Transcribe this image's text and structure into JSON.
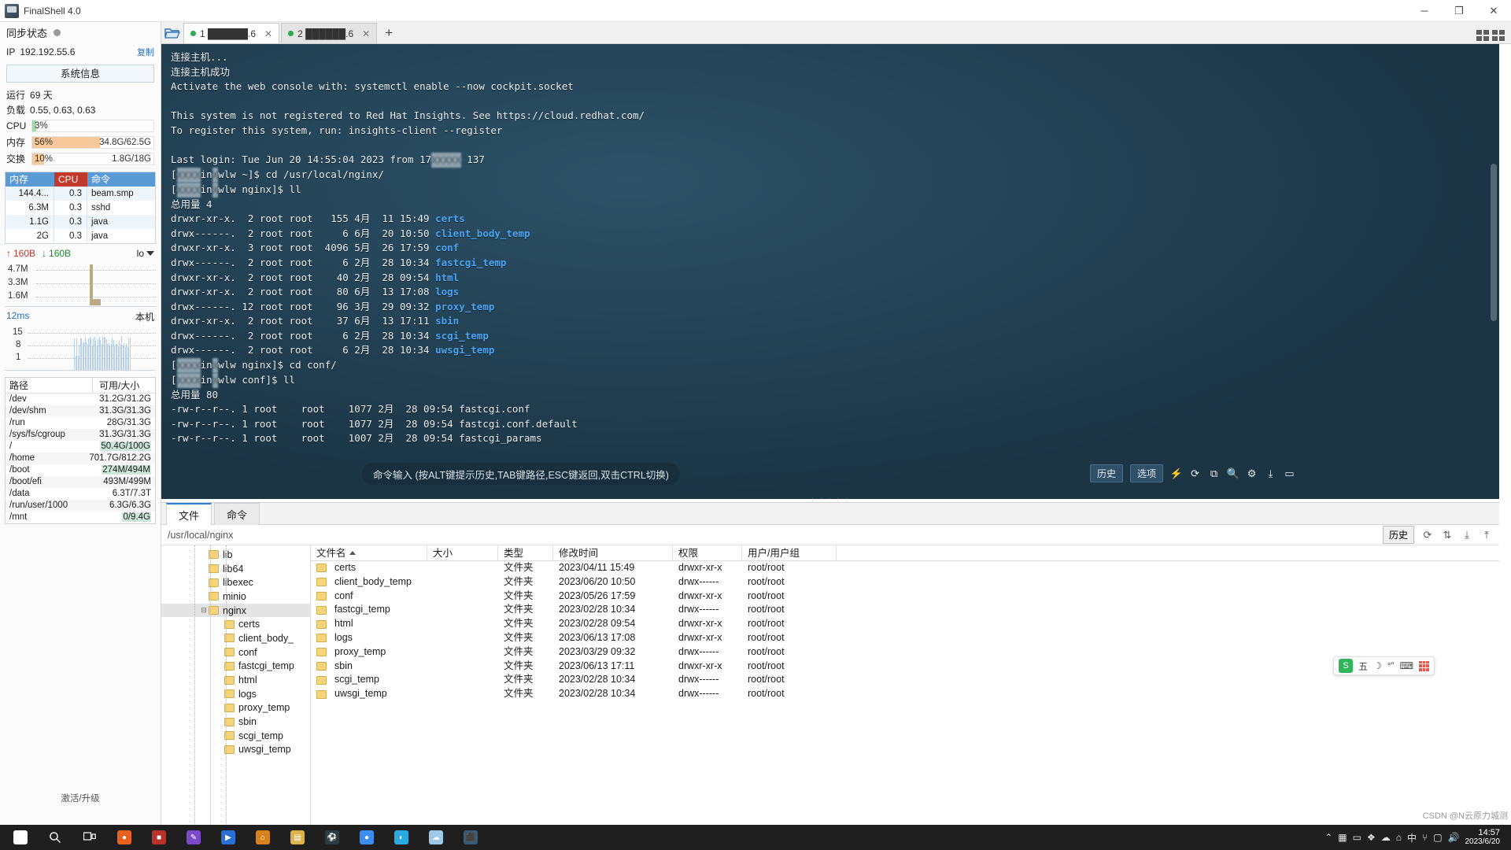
{
  "titlebar": {
    "app_title": "FinalShell 4.0",
    "minimize": "─",
    "maximize": "❐",
    "close": "✕"
  },
  "sidebar": {
    "sync_label": "同步状态",
    "ip_label": "IP",
    "ip_value": "192.192.55.6",
    "copy_label": "复制",
    "sysinfo_button": "系统信息",
    "uptime_label": "运行",
    "uptime_value": "69 天",
    "load_label": "负载",
    "load_value": "0.55, 0.63, 0.63",
    "gauges": [
      {
        "name": "CPU",
        "pct": "3%",
        "fill": 3,
        "right": "",
        "color": "#9ddfa0"
      },
      {
        "name": "内存",
        "pct": "56%",
        "fill": 56,
        "right": "34.8G/62.5G",
        "color": "#f6c89a"
      },
      {
        "name": "交换",
        "pct": "10%",
        "fill": 10,
        "right": "1.8G/18G",
        "color": "#f6c89a"
      }
    ],
    "proc_headers": {
      "mem": "内存",
      "cpu": "CPU",
      "cmd": "命令"
    },
    "processes": [
      {
        "mem": "144.4...",
        "cpu": "0.3",
        "cmd": "beam.smp"
      },
      {
        "mem": "6.3M",
        "cpu": "0.3",
        "cmd": "sshd"
      },
      {
        "mem": "1.1G",
        "cpu": "0.3",
        "cmd": "java"
      },
      {
        "mem": "2G",
        "cpu": "0.3",
        "cmd": "java"
      }
    ],
    "net": {
      "up_icon": "↑",
      "up_value": "160B",
      "down_icon": "↓",
      "down_value": "160B",
      "interface": "lo",
      "y_labels": [
        "4.7M",
        "3.3M",
        "1.6M"
      ]
    },
    "latency": {
      "value": "12ms",
      "local_label": "本机",
      "y_labels": [
        "15",
        "8",
        "1"
      ]
    },
    "disk_headers": {
      "path": "路径",
      "size": "可用/大小"
    },
    "disks": [
      {
        "path": "/dev",
        "size": "31.2G/31.2G",
        "hl": false
      },
      {
        "path": "/dev/shm",
        "size": "31.3G/31.3G",
        "hl": false
      },
      {
        "path": "/run",
        "size": "28G/31.3G",
        "hl": false
      },
      {
        "path": "/sys/fs/cgroup",
        "size": "31.3G/31.3G",
        "hl": false
      },
      {
        "path": "/",
        "size": "50.4G/100G",
        "hl": true
      },
      {
        "path": "/home",
        "size": "701.7G/812.2G",
        "hl": false
      },
      {
        "path": "/boot",
        "size": "274M/494M",
        "hl": true
      },
      {
        "path": "/boot/efi",
        "size": "493M/499M",
        "hl": false
      },
      {
        "path": "/data",
        "size": "6.3T/7.3T",
        "hl": false
      },
      {
        "path": "/run/user/1000",
        "size": "6.3G/6.3G",
        "hl": false
      },
      {
        "path": "/mnt",
        "size": "0/9.4G",
        "hl": true
      }
    ],
    "activate_label": "激活/升级"
  },
  "tabbar": {
    "folder_icon": "folder-open-icon",
    "tabs": [
      {
        "index": "1",
        "label": "1 ██████.6",
        "active": true,
        "close": "✕"
      },
      {
        "index": "2",
        "label": "2 ██████.6",
        "active": false,
        "close": "✕"
      }
    ],
    "add_tab": "+"
  },
  "terminal": {
    "lines": [
      {
        "t": "连接主机..."
      },
      {
        "t": "连接主机成功"
      },
      {
        "t": "Activate the web console with: systemctl enable --now cockpit.socket"
      },
      {
        "t": ""
      },
      {
        "t": "This system is not registered to Red Hat Insights. See https://cloud.redhat.com/"
      },
      {
        "t": "To register this system, run: insights-client --register"
      },
      {
        "t": ""
      },
      {
        "t": "Last login: Tue Jun 20 14:55:04 2023 from 17@@@@@ 137",
        "blur": true
      },
      {
        "t": "[@@@@in@wlw ~]$ cd /usr/local/nginx/",
        "blur": true
      },
      {
        "t": "[@@@@in@wlw nginx]$ ll",
        "blur": true
      },
      {
        "t": "总用量 4"
      },
      {
        "perm": "drwxr-xr-x.",
        "links": "2",
        "user": "root",
        "group": "root",
        "size": "155",
        "month": "4月",
        "day": "11",
        "time": "15:49",
        "name": "certs"
      },
      {
        "perm": "drwx------.",
        "links": "2",
        "user": "root",
        "group": "root",
        "size": "6",
        "month": "6月",
        "day": "20",
        "time": "10:50",
        "name": "client_body_temp"
      },
      {
        "perm": "drwxr-xr-x.",
        "links": "3",
        "user": "root",
        "group": "root",
        "size": "4096",
        "month": "5月",
        "day": "26",
        "time": "17:59",
        "name": "conf"
      },
      {
        "perm": "drwx------.",
        "links": "2",
        "user": "root",
        "group": "root",
        "size": "6",
        "month": "2月",
        "day": "28",
        "time": "10:34",
        "name": "fastcgi_temp"
      },
      {
        "perm": "drwxr-xr-x.",
        "links": "2",
        "user": "root",
        "group": "root",
        "size": "40",
        "month": "2月",
        "day": "28",
        "time": "09:54",
        "name": "html"
      },
      {
        "perm": "drwxr-xr-x.",
        "links": "2",
        "user": "root",
        "group": "root",
        "size": "80",
        "month": "6月",
        "day": "13",
        "time": "17:08",
        "name": "logs"
      },
      {
        "perm": "drwx------.",
        "links": "12",
        "user": "root",
        "group": "root",
        "size": "96",
        "month": "3月",
        "day": "29",
        "time": "09:32",
        "name": "proxy_temp"
      },
      {
        "perm": "drwxr-xr-x.",
        "links": "2",
        "user": "root",
        "group": "root",
        "size": "37",
        "month": "6月",
        "day": "13",
        "time": "17:11",
        "name": "sbin"
      },
      {
        "perm": "drwx------.",
        "links": "2",
        "user": "root",
        "group": "root",
        "size": "6",
        "month": "2月",
        "day": "28",
        "time": "10:34",
        "name": "scgi_temp"
      },
      {
        "perm": "drwx------.",
        "links": "2",
        "user": "root",
        "group": "root",
        "size": "6",
        "month": "2月",
        "day": "28",
        "time": "10:34",
        "name": "uwsgi_temp"
      },
      {
        "t": "[@@@@in@wlw nginx]$ cd conf/",
        "blur": true
      },
      {
        "t": "[@@@@in@wlw conf]$ ll",
        "blur": true
      },
      {
        "t": "总用量 80"
      },
      {
        "t": "-rw-r--r--. 1 root    root    1077 2月  28 09:54 fastcgi.conf"
      },
      {
        "t": "-rw-r--r--. 1 root    root    1077 2月  28 09:54 fastcgi.conf.default"
      },
      {
        "t": "-rw-r--r--. 1 root    root    1007 2月  28 09:54 fastcgi_params"
      }
    ],
    "hint": "命令输入 (按ALT键提示历史,TAB键路径,ESC键返回,双击CTRL切换)",
    "toolbar": {
      "history_label": "历史",
      "options_label": "选项",
      "icons": [
        "bolt-icon",
        "refresh-icon",
        "copy-icon",
        "search-icon",
        "gear-icon",
        "download-icon",
        "window-icon"
      ]
    }
  },
  "filepanel": {
    "tabs": [
      {
        "label": "文件",
        "active": true
      },
      {
        "label": "命令",
        "active": false
      }
    ],
    "path": "/usr/local/nginx",
    "history_label": "历史",
    "toolbar_icons": [
      "refresh-icon",
      "upload-icon",
      "download-icon",
      "upload-alt-icon"
    ],
    "tree": [
      {
        "label": "lib",
        "depth": 2,
        "expander": "",
        "selected": false
      },
      {
        "label": "lib64",
        "depth": 2,
        "expander": "",
        "selected": false
      },
      {
        "label": "libexec",
        "depth": 2,
        "expander": "",
        "selected": false
      },
      {
        "label": "minio",
        "depth": 2,
        "expander": "",
        "selected": false
      },
      {
        "label": "nginx",
        "depth": 2,
        "expander": "⊟",
        "selected": true
      },
      {
        "label": "certs",
        "depth": 3,
        "expander": "",
        "selected": false
      },
      {
        "label": "client_body_",
        "depth": 3,
        "expander": "",
        "selected": false
      },
      {
        "label": "conf",
        "depth": 3,
        "expander": "",
        "selected": false
      },
      {
        "label": "fastcgi_temp",
        "depth": 3,
        "expander": "",
        "selected": false
      },
      {
        "label": "html",
        "depth": 3,
        "expander": "",
        "selected": false
      },
      {
        "label": "logs",
        "depth": 3,
        "expander": "",
        "selected": false
      },
      {
        "label": "proxy_temp",
        "depth": 3,
        "expander": "",
        "selected": false
      },
      {
        "label": "sbin",
        "depth": 3,
        "expander": "",
        "selected": false
      },
      {
        "label": "scgi_temp",
        "depth": 3,
        "expander": "",
        "selected": false
      },
      {
        "label": "uwsgi_temp",
        "depth": 3,
        "expander": "",
        "selected": false
      }
    ],
    "columns": [
      {
        "key": "name",
        "label": "文件名",
        "sorted": true
      },
      {
        "key": "size",
        "label": "大小",
        "sorted": false
      },
      {
        "key": "type",
        "label": "类型",
        "sorted": false
      },
      {
        "key": "time",
        "label": "修改时间",
        "sorted": false
      },
      {
        "key": "perm",
        "label": "权限",
        "sorted": false
      },
      {
        "key": "own",
        "label": "用户/用户组",
        "sorted": false
      }
    ],
    "rows": [
      {
        "name": "certs",
        "size": "",
        "type": "文件夹",
        "time": "2023/04/11 15:49",
        "perm": "drwxr-xr-x",
        "own": "root/root"
      },
      {
        "name": "client_body_temp",
        "size": "",
        "type": "文件夹",
        "time": "2023/06/20 10:50",
        "perm": "drwx------",
        "own": "root/root"
      },
      {
        "name": "conf",
        "size": "",
        "type": "文件夹",
        "time": "2023/05/26 17:59",
        "perm": "drwxr-xr-x",
        "own": "root/root"
      },
      {
        "name": "fastcgi_temp",
        "size": "",
        "type": "文件夹",
        "time": "2023/02/28 10:34",
        "perm": "drwx------",
        "own": "root/root"
      },
      {
        "name": "html",
        "size": "",
        "type": "文件夹",
        "time": "2023/02/28 09:54",
        "perm": "drwxr-xr-x",
        "own": "root/root"
      },
      {
        "name": "logs",
        "size": "",
        "type": "文件夹",
        "time": "2023/06/13 17:08",
        "perm": "drwxr-xr-x",
        "own": "root/root"
      },
      {
        "name": "proxy_temp",
        "size": "",
        "type": "文件夹",
        "time": "2023/03/29 09:32",
        "perm": "drwx------",
        "own": "root/root"
      },
      {
        "name": "sbin",
        "size": "",
        "type": "文件夹",
        "time": "2023/06/13 17:11",
        "perm": "drwxr-xr-x",
        "own": "root/root"
      },
      {
        "name": "scgi_temp",
        "size": "",
        "type": "文件夹",
        "time": "2023/02/28 10:34",
        "perm": "drwx------",
        "own": "root/root"
      },
      {
        "name": "uwsgi_temp",
        "size": "",
        "type": "文件夹",
        "time": "2023/02/28 10:34",
        "perm": "drwx------",
        "own": "root/root"
      }
    ]
  },
  "sogou": {
    "logo": "S",
    "mode": "五",
    "moon": "☽",
    "quote": "°”",
    "kb": "⌨",
    "grid": "grid-icon"
  },
  "taskbar": {
    "start_icon": "windows-icon",
    "search_icon": "search-icon",
    "taskview_icon": "task-view-icon",
    "apps": [
      {
        "name": "firefox",
        "color": "#e8621f",
        "glyph": "●"
      },
      {
        "name": "app-red",
        "color": "#b8322c",
        "glyph": "■"
      },
      {
        "name": "app-purple",
        "color": "#7c4ac9",
        "glyph": "✎"
      },
      {
        "name": "app-blue",
        "color": "#2a6fd4",
        "glyph": "▶"
      },
      {
        "name": "app-orange",
        "color": "#d8821e",
        "glyph": "⌂"
      },
      {
        "name": "app-folder",
        "color": "#dcb24c",
        "glyph": "▤"
      },
      {
        "name": "app-dark",
        "color": "#2b3b46",
        "glyph": "⚽"
      },
      {
        "name": "chrome",
        "color": "#3b8ef0",
        "glyph": "●"
      },
      {
        "name": "edge",
        "color": "#2aa9e0",
        "glyph": "◐"
      },
      {
        "name": "cloud",
        "color": "#9ec8e8",
        "glyph": "☁"
      },
      {
        "name": "finalshell",
        "color": "#3a5a75",
        "glyph": "⬛"
      }
    ],
    "tray_icons": [
      "chevron-up-icon",
      "network-icon",
      "battery-icon",
      "shield-icon",
      "cloud-icon",
      "pin-icon",
      "cn-icon",
      "usb-icon",
      "monitor-icon",
      "volume-icon"
    ],
    "tray_label": "CSDN @N云原力城测",
    "clock_time": "14:57",
    "clock_date": "2023/6/20"
  }
}
